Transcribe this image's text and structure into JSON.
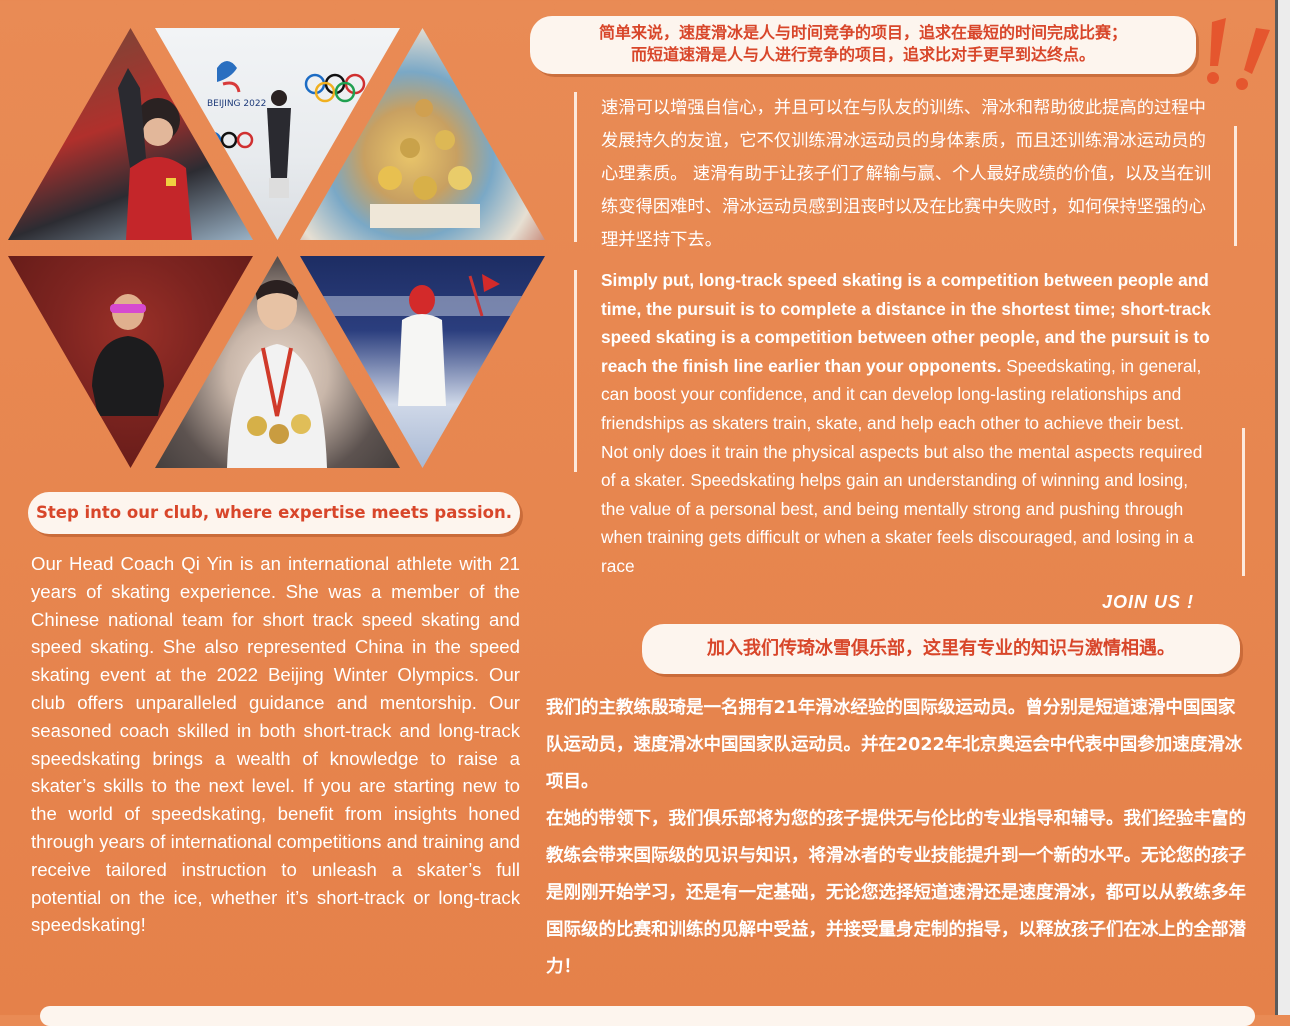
{
  "colors": {
    "background": "#e7864f",
    "pill_bg": "#fdf5ee",
    "accent_red": "#d8462a",
    "text": "#ffffff"
  },
  "photos": [
    {
      "name": "skater-raising-arm"
    },
    {
      "name": "beijing-2022-logo-and-athlete"
    },
    {
      "name": "medals-and-certificates"
    },
    {
      "name": "athlete-in-sunglasses"
    },
    {
      "name": "athlete-with-medals"
    },
    {
      "name": "athlete-in-ceremony"
    }
  ],
  "beijing_logo_text": "BEIJING 2022",
  "top_banner": {
    "line1": "简单来说，速度滑冰是人与时间竞争的项目，追求在最短的时间完成比赛；",
    "line2": "而短道速滑是人与人进行竞争的项目，追求比对手更早到达终点。"
  },
  "cn_intro": "速滑可以增强自信心，并且可以在与队友的训练、滑冰和帮助彼此提高的过程中发展持久的友谊，它不仅训练滑冰运动员的身体素质，而且还训练滑冰运动员的心理素质。 速滑有助于让孩子们了解输与赢、个人最好成绩的价值，以及当在训练变得困难时、滑冰运动员感到沮丧时以及在比赛中失败时，如何保持坚强的心理并坚持下去。",
  "en_bold": "Simply put, long-track speed skating is a competition between people and time, the pursuit is to complete a distance in the shortest time; short-track speed skating is a competition between other people, and the pursuit is to reach the finish line earlier than your opponents.",
  "en_body": "Speedskating, in general, can boost your confidence, and it can develop long-lasting relationships and friendships as skaters train, skate, and help each other to achieve their best. Not only does it train the physical aspects but also the mental aspects required of a skater. Speedskating helps gain an understanding of winning and losing, the value of a personal best, and being mentally strong and pushing through when training gets difficult or when a skater feels discouraged, and losing in a race",
  "join_us": "JOIN US !",
  "join_banner": "加入我们传琦冰雪俱乐部，这里有专业的知识与激情相遇。",
  "left_banner": "Step into our club, where expertise meets passion.",
  "left_body": "Our Head Coach Qi Yin is an international athlete with 21 years of skating experience. She was a member of the Chinese national team for short track speed skating and speed skating. She also represented China in the speed skating event at the 2022 Beijing Winter Olympics. Our club offers unparalleled guidance and mentorship. Our seasoned coach skilled in both short-track and long-track speedskating brings a wealth of knowledge to raise a skater’s skills to the next level. If you are starting new to the world of speedskating, benefit from insights honed through years of international competitions and training and receive tailored instruction to unleash a skater’s full potential on the ice, whether it’s short-track or long-track speedskating!",
  "cn_bottom": {
    "p1": "我们的主教练殷琦是一名拥有21年滑冰经验的国际级运动员。曾分别是短道速滑中国国家队运动员，速度滑冰中国国家队运动员。并在2022年北京奥运会中代表中国参加速度滑冰项目。",
    "p2": "在她的带领下，我们俱乐部将为您的孩子提供无与伦比的专业指导和辅导。我们经验丰富的教练会带来国际级的见识与知识，将滑冰者的专业技能提升到一个新的水平。无论您的孩子是刚刚开始学习，还是有一定基础，无论您选择短道速滑还是速度滑冰，都可以从教练多年国际级的比赛和训练的见解中受益，并接受量身定制的指导，以释放孩子们在冰上的全部潜力！"
  }
}
